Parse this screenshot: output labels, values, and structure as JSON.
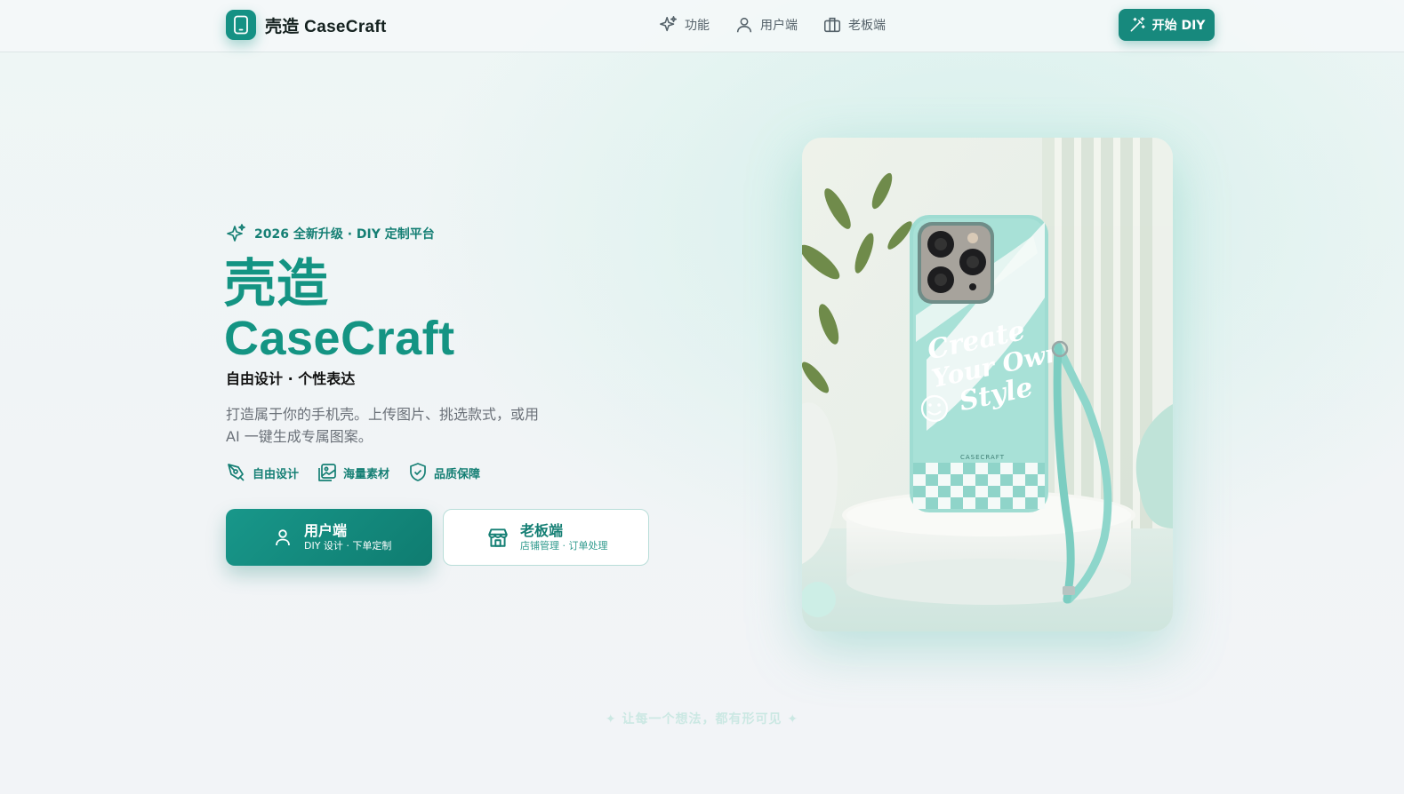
{
  "brand": {
    "name": "壳造 CaseCraft",
    "logo_icon": "phone-icon"
  },
  "nav": {
    "items": [
      {
        "label": "功能",
        "icon": "sparkle-icon"
      },
      {
        "label": "用户端",
        "icon": "user-icon"
      },
      {
        "label": "老板端",
        "icon": "briefcase-icon"
      }
    ],
    "cta_label": "开始 DIY"
  },
  "hero": {
    "badge": "2026 全新升级 · DIY 定制平台",
    "title_cn": "壳造",
    "title_en": "CaseCraft",
    "subtitle": "自由设计 · 个性表达",
    "description": "打造属于你的手机壳。上传图片、挑选款式，或用 AI 一键生成专属图案。",
    "features": [
      {
        "label": "自由设计",
        "icon": "pen-tool-icon"
      },
      {
        "label": "海量素材",
        "icon": "images-icon"
      },
      {
        "label": "品质保障",
        "icon": "shield-check-icon"
      }
    ],
    "buttons": {
      "user": {
        "title": "用户端",
        "subtitle": "DIY 设计 · 下单定制"
      },
      "boss": {
        "title": "老板端",
        "subtitle": "店铺管理 · 订单处理"
      }
    },
    "image": {
      "case_text_1": "Create",
      "case_text_2": "Your Own",
      "case_text_3": "Style",
      "case_brand": "CASECRAFT"
    }
  },
  "tagline": "✦ 让每一个想法，都有形可见 ✦",
  "colors": {
    "accent": "#149483",
    "accent_dark": "#0f7c70",
    "mint": "#8fd8ce"
  }
}
